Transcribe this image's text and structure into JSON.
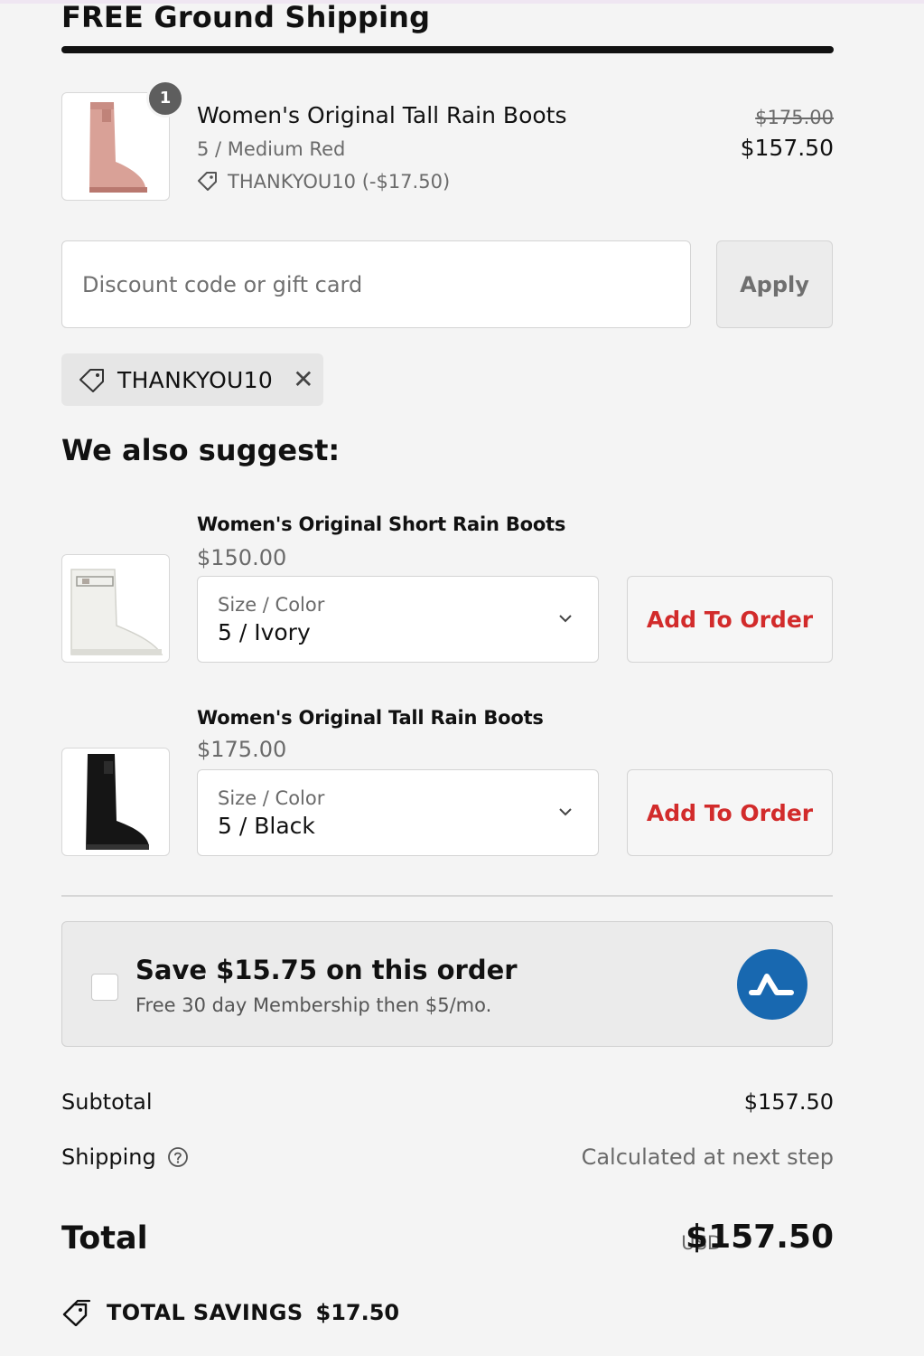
{
  "header": {
    "title": "FREE Ground Shipping"
  },
  "cart_item": {
    "quantity": "1",
    "name": "Women's Original Tall Rain Boots",
    "variant": "5 / Medium Red",
    "discount": "THANKYOU10 (-$17.50)",
    "original_price": "$175.00",
    "price": "$157.50",
    "image": "pink-tall-rain-boot",
    "image_color": "#d9a197"
  },
  "discount_form": {
    "placeholder": "Discount code or gift card",
    "value": "",
    "apply_label": "Apply"
  },
  "applied_code": {
    "code": "THANKYOU10",
    "remove_icon": "close-icon"
  },
  "suggestions": {
    "heading": "We also suggest:",
    "select_label": "Size / Color",
    "add_label": "Add To Order",
    "items": [
      {
        "name": "Women's Original Short Rain Boots",
        "price": "$150.00",
        "selected": "5 / Ivory",
        "image": "ivory-short-rain-boot",
        "image_color": "#f2f2ee"
      },
      {
        "name": "Women's Original Tall Rain Boots",
        "price": "$175.00",
        "selected": "5 / Black",
        "image": "black-tall-rain-boot",
        "image_color": "#151515"
      }
    ]
  },
  "membership": {
    "title": "Save $15.75 on this order",
    "subtitle": "Free 30 day Membership then $5/mo.",
    "logo_color": "#1868b0",
    "checked": false
  },
  "summary": {
    "subtotal_label": "Subtotal",
    "subtotal_value": "$157.50",
    "shipping_label": "Shipping",
    "shipping_value": "Calculated at next step",
    "total_label": "Total",
    "currency": "USD",
    "total_value": "$157.50",
    "savings_label": "TOTAL SAVINGS",
    "savings_value": "$17.50"
  },
  "colors": {
    "accent_red": "#d22b2b",
    "background": "#f4f4f4"
  }
}
